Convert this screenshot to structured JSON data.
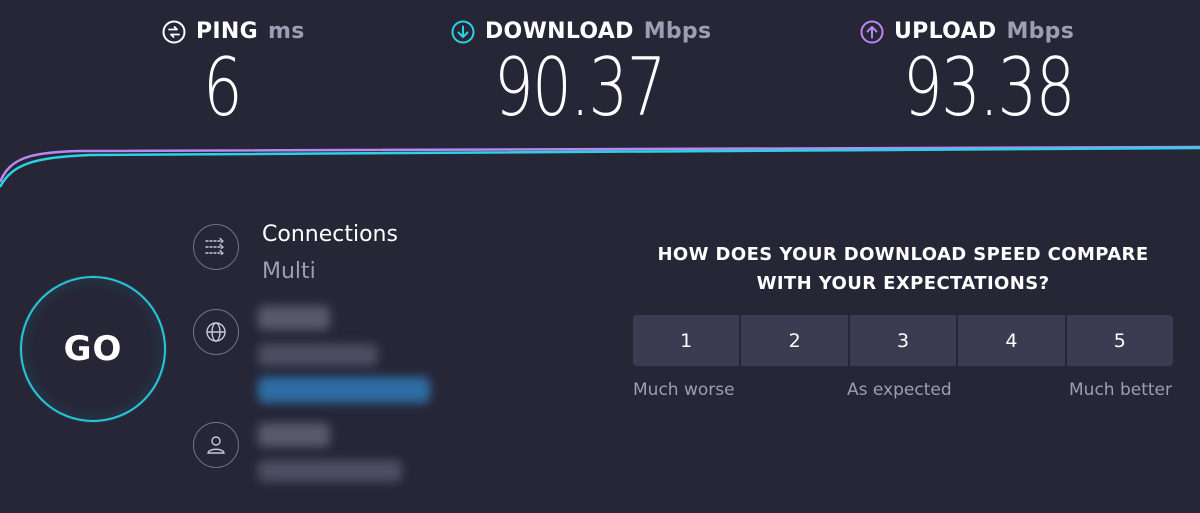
{
  "metrics": {
    "ping": {
      "label": "PING",
      "unit": "ms",
      "value": "6",
      "icon": "ping-icon",
      "color": "#ffffff"
    },
    "download": {
      "label": "DOWNLOAD",
      "unit": "Mbps",
      "value": "90.37",
      "icon": "download-arrow-icon",
      "color": "#2ad3e4"
    },
    "upload": {
      "label": "UPLOAD",
      "unit": "Mbps",
      "value": "93.38",
      "icon": "upload-arrow-icon",
      "color": "#b887f3"
    }
  },
  "go_button": {
    "label": "GO"
  },
  "connections": {
    "title": "Connections",
    "value": "Multi",
    "icon": "connections-icon"
  },
  "server": {
    "icon": "globe-icon"
  },
  "host": {
    "icon": "user-icon"
  },
  "survey": {
    "question": "HOW DOES YOUR DOWNLOAD SPEED COMPARE WITH YOUR EXPECTATIONS?",
    "options": [
      "1",
      "2",
      "3",
      "4",
      "5"
    ],
    "scale_labels": {
      "low": "Much worse",
      "mid": "As expected",
      "high": "Much better"
    }
  },
  "colors": {
    "background": "#262637",
    "accent_cyan": "#2ad3e4",
    "accent_purple": "#b887f3",
    "muted_text": "#9d9db4",
    "button_bg": "#3b3b51"
  }
}
